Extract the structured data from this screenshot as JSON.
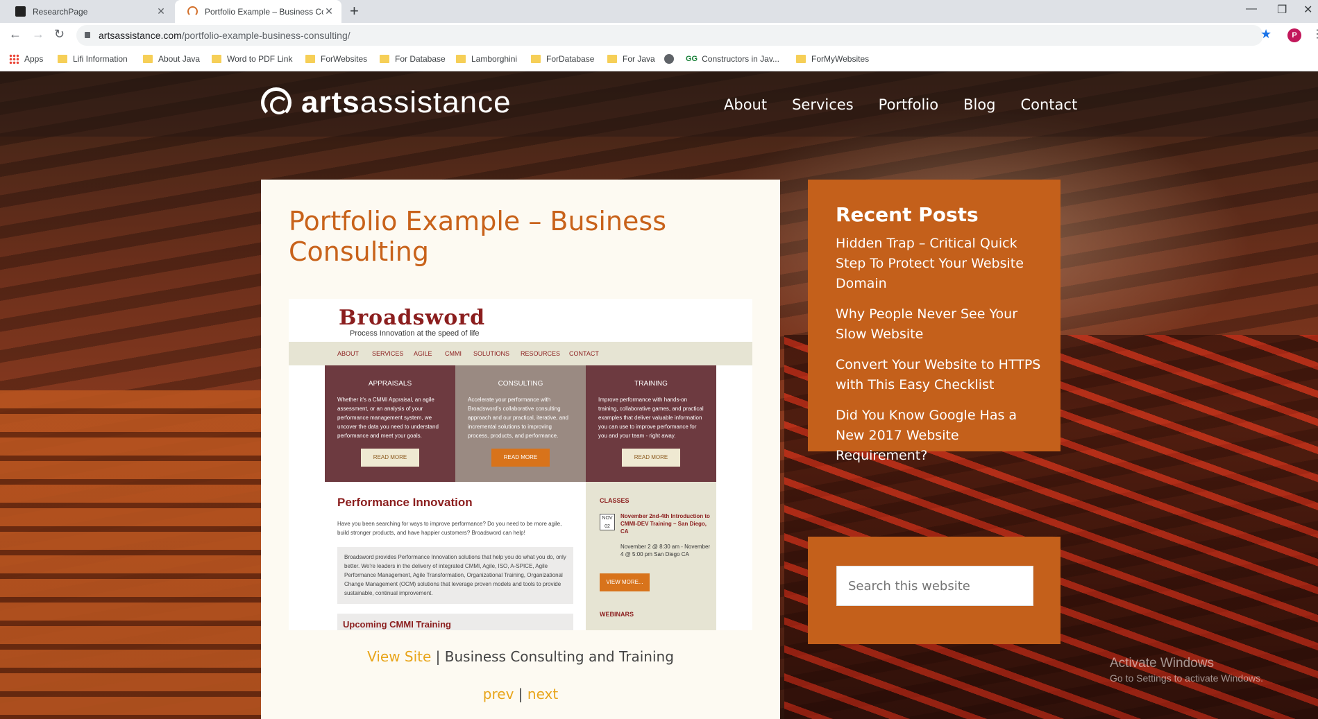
{
  "browser": {
    "tabs": [
      {
        "title": "ResearchPage"
      },
      {
        "title": "Portfolio Example – Business Con"
      }
    ],
    "new_tab": "+",
    "window_controls": {
      "minimize": "—",
      "restore": "❐",
      "close": "✕"
    },
    "url_host": "artsassistance.com",
    "url_path": "/portfolio-example-business-consulting/",
    "profile_initial": "P",
    "bookmarks": [
      {
        "label": "Apps",
        "icon": "apps-grid-icon"
      },
      {
        "label": "Lifi Information",
        "icon": "folder-icon"
      },
      {
        "label": "About Java",
        "icon": "folder-icon"
      },
      {
        "label": "Word to PDF Link",
        "icon": "folder-icon"
      },
      {
        "label": "ForWebsites",
        "icon": "folder-icon"
      },
      {
        "label": "For Database",
        "icon": "folder-icon"
      },
      {
        "label": "Lamborghini",
        "icon": "folder-icon"
      },
      {
        "label": "ForDatabase",
        "icon": "folder-icon"
      },
      {
        "label": "For Java",
        "icon": "folder-icon"
      },
      {
        "label": "",
        "icon": "globe-icon"
      },
      {
        "label": "Constructors in Jav...",
        "icon": "gg-icon"
      },
      {
        "label": "ForMyWebsites",
        "icon": "folder-icon"
      }
    ]
  },
  "site": {
    "logo_bold": "arts",
    "logo_light": "assistance",
    "nav": [
      "About",
      "Services",
      "Portfolio",
      "Blog",
      "Contact"
    ],
    "accent": "#c8621a",
    "widget_color": "#c4601b"
  },
  "post": {
    "title": "Portfolio Example – Business Consulting",
    "view_site": "View Site",
    "separator": "|",
    "caption_rest": "Business Consulting and Training",
    "prev": "prev",
    "next": "next"
  },
  "screenshot": {
    "logo": "Broadsword",
    "tagline": "Process Innovation at the speed of life",
    "nav": [
      "ABOUT",
      "SERVICES",
      "AGILE",
      "CMMI",
      "SOLUTIONS",
      "RESOURCES",
      "CONTACT"
    ],
    "panels": [
      {
        "heading": "APPRAISALS",
        "text": "Whether it's a CMMI Appraisal, an agile assessment, or an analysis of your performance management system, we uncover the data you need to understand performance and meet your goals.",
        "button": "READ MORE"
      },
      {
        "heading": "CONSULTING",
        "text": "Accelerate your performance with Broadsword's collaborative consulting approach and our practical, iterative, and incremental solutions to improving process, products, and performance.",
        "button": "READ MORE"
      },
      {
        "heading": "TRAINING",
        "text": "Improve performance with hands-on training, collaborative games, and practical examples that deliver valuable information you can use to improve performance for you and your team - right away.",
        "button": "READ MORE"
      }
    ],
    "main_heading": "Performance Innovation",
    "main_text": "Have you been searching for ways to improve performance? Do you need to be more agile, build stronger products, and have happier customers? Broadsword can help!",
    "box_text": "Broadsword provides Performance Innovation solutions that help you do what you do, only better. We're leaders in the delivery of integrated CMMI, Agile, ISO, A-SPICE, Agile Performance Management, Agile Transformation, Organizational Training, Organizational Change Management (OCM) solutions that leverage proven models and tools to provide sustainable, continual improvement.",
    "sub_heading": "Upcoming CMMI Training",
    "classes_label": "CLASSES",
    "date_month": "NOV",
    "date_day": "02",
    "event_title": "November 2nd-4th Introduction to CMMI-DEV Training – San Diego, CA",
    "event_details": "November 2 @ 8:30 am - November 4 @ 5:00 pm San Diego CA",
    "view_more": "VIEW MORE...",
    "webinars_label": "WEBINARS"
  },
  "sidebar": {
    "recent_title": "Recent Posts",
    "recent_posts": [
      "Hidden Trap – Critical Quick Step To Protect Your Website Domain",
      "Why People Never See Your Slow Website",
      "Convert Your Website to HTTPS with This Easy Checklist",
      "Did You Know Google Has a New 2017 Website Requirement?"
    ],
    "search_placeholder": "Search this website"
  },
  "watermark": {
    "line1": "Activate Windows",
    "line2": "Go to Settings to activate Windows."
  }
}
